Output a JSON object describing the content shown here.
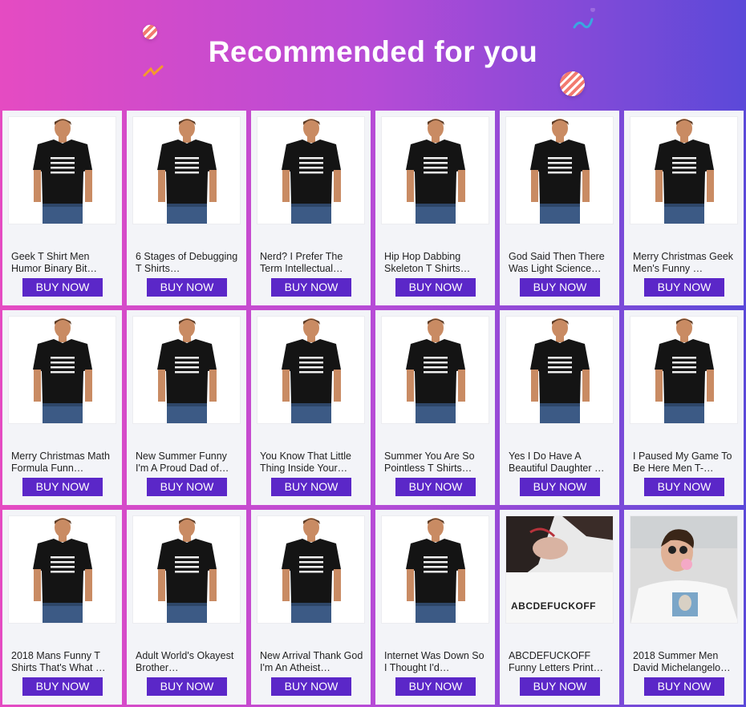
{
  "header": {
    "title": "Recommended for you"
  },
  "products": [
    {
      "title": "Geek T Shirt Men Humor Binary Bit…",
      "button": "BUY NOW",
      "image": "tshirt-black-binary-print"
    },
    {
      "title": "6 Stages of Debugging T Shirts…",
      "button": "BUY NOW",
      "image": "tshirt-black-text-list-print"
    },
    {
      "title": "Nerd? I Prefer The Term Intellectual…",
      "button": "BUY NOW",
      "image": "tshirt-black-nerd-print"
    },
    {
      "title": "Hip Hop Dabbing Skeleton T Shirts…",
      "button": "BUY NOW",
      "image": "tshirt-black-skeleton-print"
    },
    {
      "title": "God Said Then There Was Light Science…",
      "button": "BUY NOW",
      "image": "tshirt-black-equations-print"
    },
    {
      "title": "Merry Christmas Geek Men's Funny …",
      "button": "BUY NOW",
      "image": "tshirt-black-code-print"
    },
    {
      "title": "Merry Christmas Math Formula Funn…",
      "button": "BUY NOW",
      "image": "tshirt-black-formula-print"
    },
    {
      "title": "New Summer Funny I'm A Proud Dad of…",
      "button": "BUY NOW",
      "image": "tshirt-black-proud-dad-print"
    },
    {
      "title": "You Know That Little Thing Inside Your…",
      "button": "BUY NOW",
      "image": "tshirt-black-little-thing-print"
    },
    {
      "title": "Summer You Are So Pointless T Shirts…",
      "button": "BUY NOW",
      "image": "tshirt-black-triangle-print"
    },
    {
      "title": "Yes I Do Have A Beautiful Daughter …",
      "button": "BUY NOW",
      "image": "tshirt-black-daughter-print"
    },
    {
      "title": "I Paused My Game To Be Here Men T-…",
      "button": "BUY NOW",
      "image": "tshirt-black-gamepad-print"
    },
    {
      "title": "2018 Mans Funny T Shirts That's What …",
      "button": "BUY NOW",
      "image": "tshirt-black-smoke-print"
    },
    {
      "title": "Adult World's Okayest Brother…",
      "button": "BUY NOW",
      "image": "tshirt-black-okayest-print"
    },
    {
      "title": "New Arrival Thank God I'm An Atheist…",
      "button": "BUY NOW",
      "image": "tshirt-black-atheist-print"
    },
    {
      "title": "Internet Was Down So I Thought I'd…",
      "button": "BUY NOW",
      "image": "tshirt-black-internet-print"
    },
    {
      "title": "ABCDEFUCKOFF Funny Letters Print…",
      "button": "BUY NOW",
      "image": "tshirt-white-letters-photo"
    },
    {
      "title": "2018 Summer Men David Michelangelo…",
      "button": "BUY NOW",
      "image": "tshirt-white-david-photo"
    }
  ],
  "photo_text": {
    "letters": "ABCDEFUCKOFF"
  },
  "colors": {
    "button": "#5b27c8",
    "card": "#f3f4f8",
    "gradient_left": "#e54bc2",
    "gradient_right": "#5b49d9"
  }
}
